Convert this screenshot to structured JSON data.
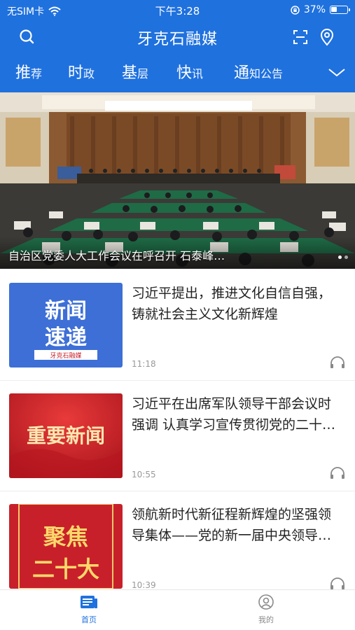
{
  "status_bar": {
    "carrier": "无SIM卡",
    "time": "下午3:28",
    "battery_text": "37%",
    "battery_level": 0.37
  },
  "header": {
    "title": "牙克石融媒"
  },
  "tabs": [
    {
      "big": "推",
      "small": "荐"
    },
    {
      "big": "时",
      "small": "政"
    },
    {
      "big": "基",
      "small": "层"
    },
    {
      "big": "快",
      "small": "讯"
    },
    {
      "big": "通",
      "small": "知公告"
    }
  ],
  "banner": {
    "caption": "自治区党委人大工作会议在呼召开 石泰峰…"
  },
  "news": [
    {
      "title": "习近平提出，推进文化自信自强，铸就社会主义文化新辉煌",
      "time": "11:18",
      "thumb_line1": "新闻",
      "thumb_line2": "速递",
      "thumb_tag": "牙克石融媒"
    },
    {
      "title": "习近平在出席军队领导干部会议时强调 认真学习宣传贯彻党的二十大精神",
      "time": "10:55",
      "thumb_line1": "重要新闻"
    },
    {
      "title": "领航新时代新征程新辉煌的坚强领导集体——党的新一届中央领导机构产生纪实",
      "time": "10:39",
      "thumb_line1": "聚焦",
      "thumb_line2": "二十大"
    }
  ],
  "tabbar": {
    "home": "首页",
    "mine": "我的"
  },
  "colors": {
    "brand_blue": "#1f71de",
    "thumb_blue": "#3d6fd6",
    "thumb_red": "#c8202a"
  }
}
